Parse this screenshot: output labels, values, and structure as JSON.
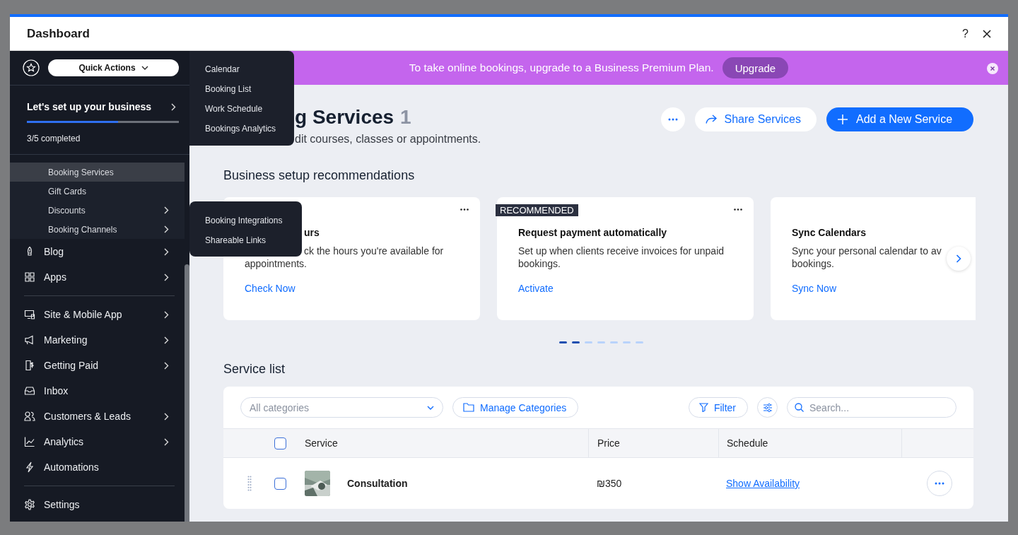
{
  "window": {
    "title": "Dashboard",
    "help": "?"
  },
  "sidebar": {
    "quick_actions": "Quick Actions",
    "setup": {
      "title": "Let's set up your business",
      "level": 0.6,
      "progress": "3/5 completed"
    },
    "subitems": [
      {
        "label": "Booking Services",
        "selected": true,
        "submenu": false
      },
      {
        "label": "Gift Cards",
        "selected": false,
        "submenu": false
      },
      {
        "label": "Discounts",
        "selected": false,
        "submenu": true
      },
      {
        "label": "Booking Channels",
        "selected": false,
        "submenu": true
      }
    ],
    "groups": [
      [
        {
          "label": "Blog",
          "submenu": true
        },
        {
          "label": "Apps",
          "submenu": true
        }
      ],
      [
        {
          "label": "Site & Mobile App",
          "submenu": true
        },
        {
          "label": "Marketing",
          "submenu": true
        },
        {
          "label": "Getting Paid",
          "submenu": true
        },
        {
          "label": "Inbox",
          "submenu": false
        },
        {
          "label": "Customers & Leads",
          "submenu": true
        },
        {
          "label": "Analytics",
          "submenu": true
        },
        {
          "label": "Automations",
          "submenu": false
        }
      ],
      [
        {
          "label": "Settings",
          "submenu": false
        }
      ]
    ]
  },
  "quick_actions_menu": [
    "Calendar",
    "Booking List",
    "Work Schedule",
    "Bookings Analytics"
  ],
  "channels_menu": [
    "Booking Integrations",
    "Shareable Links"
  ],
  "banner": {
    "text": "To take online bookings, upgrade to a Business Premium Plan.",
    "button": "Upgrade"
  },
  "page": {
    "title": "g Services",
    "count": "1",
    "subtitle": "dit courses, classes or appointments.",
    "share": "Share Services",
    "add": "Add a New Service"
  },
  "recommendations": {
    "title": "Business setup recommendations",
    "cards": [
      {
        "title": "urs",
        "description": [
          "ck the hours you're available for",
          "appointments."
        ],
        "action": "Check Now",
        "menu": true
      },
      {
        "badge": "RECOMMENDED",
        "title": "Request payment automatically",
        "description": [
          "Set up when clients receive invoices for unpaid",
          "bookings."
        ],
        "action": "Activate",
        "menu": true
      },
      {
        "title": "Sync Calendars",
        "description": [
          "Sync your personal calendar to av",
          "bookings."
        ],
        "action": "Sync Now"
      }
    ],
    "dots": [
      {
        "selected": true
      },
      {
        "selected": true
      },
      {
        "selected": false
      },
      {
        "selected": false
      },
      {
        "selected": false
      },
      {
        "selected": false
      },
      {
        "selected": false
      }
    ]
  },
  "service_list": {
    "title": "Service list",
    "category_placeholder": "All categories",
    "manage": "Manage Categories",
    "filter": "Filter",
    "search_placeholder": "Search...",
    "all_checked": false,
    "columns": [
      "Service",
      "Price",
      "Schedule"
    ],
    "rows": [
      {
        "checked": false,
        "name": "Consultation",
        "price": "₪350",
        "schedule": "Show Availability"
      }
    ]
  }
}
